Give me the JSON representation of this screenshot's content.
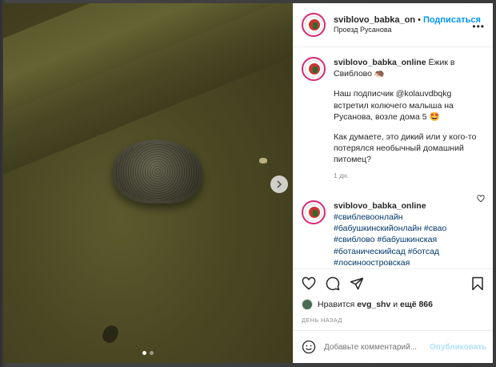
{
  "post": {
    "username": "sviblovo_babka_on",
    "follow_label": "Подписаться",
    "separator": "•",
    "location": "Проезд Русанова"
  },
  "caption": {
    "username": "sviblovo_babka_online",
    "title": "Ёжик в Свиблово 🦔",
    "paragraph1": "Наш подписчик @kolauvdbqkg встретил колючего малыша на Русанова, возле дома 5 🤩",
    "paragraph2": "Как думаете, это дикий или у кого-то потерялся необычный домашний питомец?",
    "time": "1 дн."
  },
  "comment": {
    "username": "sviblovo_babka_online",
    "tags": "#свиблевоонлайн #бабушкинскийонлайн #свао #свиблово #бабушкинская #ботаническийсад #ботсад #лосиноостровская"
  },
  "likes": {
    "prefix": "Нравится",
    "user": "evg_shv",
    "middle": "и",
    "rest": "ещё 866"
  },
  "posted_ago": "ДЕНЬ НАЗАД",
  "add_comment": {
    "placeholder": "Добавьте комментарий...",
    "publish_label": "Опубликовать"
  },
  "carousel": {
    "total": 2,
    "active": 1
  },
  "colors": {
    "accent": "#0095f6",
    "tag": "#00376b",
    "muted": "#8e8e8e"
  },
  "icons": [
    "chevron-right-icon",
    "more-icon",
    "heart-icon",
    "comment-icon",
    "share-icon",
    "bookmark-icon",
    "emoji-icon"
  ]
}
